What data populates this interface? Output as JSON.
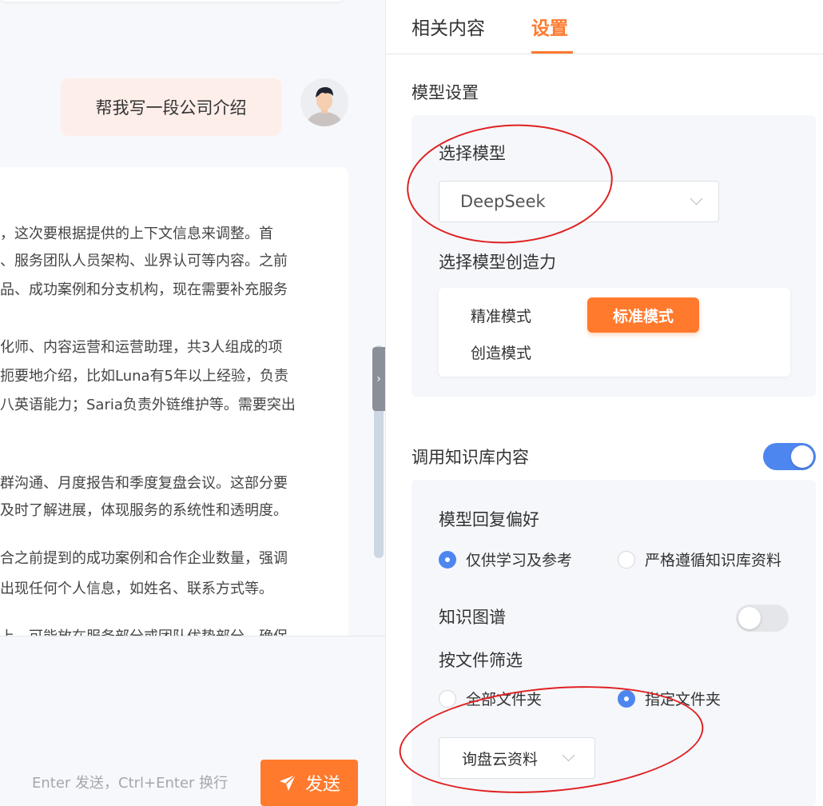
{
  "chat": {
    "user_message": "帮我写一段公司介绍",
    "ai_lines": [
      "，这次要根据提供的上下文信息来调整。首",
      "、服务团队人员架构、业界认可等内容。之前",
      "品、成功案例和分支机构，现在需要补充服务",
      "化师、内容运营和运营助理，共3人组成的项",
      "扼要地介绍，比如Luna有5年以上经验，负责",
      "八英语能力；Saria负责外链维护等。需要突出",
      "群沟通、月度报告和季度复盘会议。这部分要",
      "及时了解进展，体现服务的系统性和透明度。",
      "合之前提到的成功案例和合作企业数量，强调",
      "出现任何个人信息，如姓名、联系方式等。",
      "上，可能放在服务部分或团队优势部分，确保"
    ],
    "input_hint": "Enter 发送，Ctrl+Enter 换行",
    "send_label": "发送"
  },
  "tabs": [
    {
      "label": "相关内容",
      "active": false
    },
    {
      "label": "设置",
      "active": true
    }
  ],
  "settings": {
    "model_section_title": "模型设置",
    "select_model_label": "选择模型",
    "selected_model": "DeepSeek",
    "creativity_label": "选择模型创造力",
    "modes": {
      "precise": "精准模式",
      "standard": "标准模式",
      "creative": "创造模式",
      "selected": "标准模式"
    },
    "kb_section_title": "调用知识库内容",
    "kb_enabled": true,
    "preference_label": "模型回复偏好",
    "preference_options": [
      "仅供学习及参考",
      "严格遵循知识库资料"
    ],
    "preference_selected": "仅供学习及参考",
    "graph_label": "知识图谱",
    "graph_enabled": false,
    "file_filter_label": "按文件筛选",
    "file_filter_options": [
      "全部文件夹",
      "指定文件夹"
    ],
    "file_filter_selected": "指定文件夹",
    "selected_folder": "询盘云资料"
  },
  "colors": {
    "accent": "#ff7a2d",
    "toggle_on": "#4e86f0",
    "annotation": "#e02020",
    "user_bubble": "#fdeee9"
  },
  "icons": {
    "send": "paper-plane-icon",
    "collapse": "chevron-right-icon",
    "dropdown": "chevron-down-icon"
  }
}
